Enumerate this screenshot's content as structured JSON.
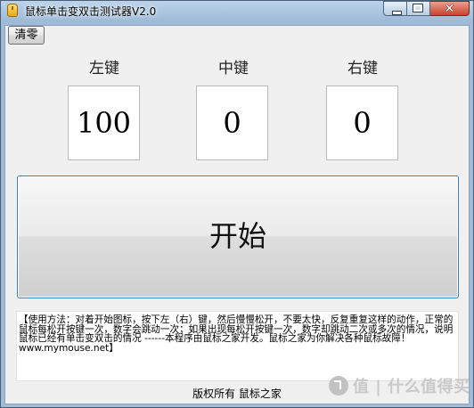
{
  "window": {
    "title": "鼠标单击变双击测试器V2.0",
    "caption_buttons": {
      "minimize": "minimize-icon",
      "maximize": "maximize-icon",
      "close": "✕"
    }
  },
  "toolbar": {
    "reset_label": "清零"
  },
  "counters": [
    {
      "label": "左键",
      "value": "100"
    },
    {
      "label": "中键",
      "value": "0"
    },
    {
      "label": "右键",
      "value": "0"
    }
  ],
  "start_button": {
    "label": "开始"
  },
  "instructions": {
    "text": "【使用方法：对着开始图标，按下左（右）键，然后慢慢松开，不要太快，反复重复这样的动作，正常的鼠标每松开按键一次，数字会跳动一次；如果出现每松开按键一次，数字却跳动二次或多次的情况，说明鼠标已经有单击变双击的情况 ------本程序由鼠标之家开发。鼠标之家为你解决各种鼠标故障！ www.mymouse.net】"
  },
  "footer": {
    "copyright": "版权所有 鼠标之家"
  },
  "watermark": {
    "icon": "zhi-icon",
    "text": "值 | 什么值得买"
  }
}
